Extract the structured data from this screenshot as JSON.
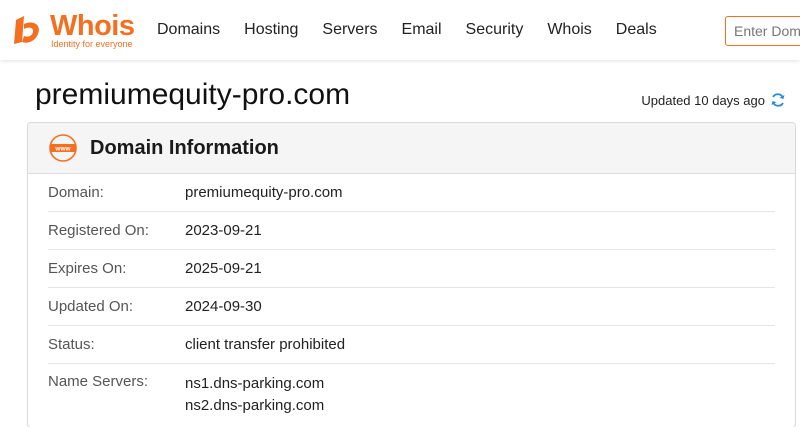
{
  "brand": {
    "name": "Whois",
    "tagline": "Identity for everyone",
    "accent": "#f37021"
  },
  "nav": {
    "items": [
      "Domains",
      "Hosting",
      "Servers",
      "Email",
      "Security",
      "Whois",
      "Deals"
    ]
  },
  "search": {
    "placeholder": "Enter Domain or IP"
  },
  "page": {
    "domain": "premiumequity-pro.com",
    "updated_text": "Updated 10 days ago"
  },
  "card": {
    "title": "Domain Information",
    "icon": "www-icon",
    "rows": [
      {
        "label": "Domain:",
        "value": "premiumequity-pro.com"
      },
      {
        "label": "Registered On:",
        "value": "2023-09-21"
      },
      {
        "label": "Expires On:",
        "value": "2025-09-21"
      },
      {
        "label": "Updated On:",
        "value": "2024-09-30"
      },
      {
        "label": "Status:",
        "value": "client transfer prohibited"
      }
    ],
    "name_servers": {
      "label": "Name Servers:",
      "values": [
        "ns1.dns-parking.com",
        "ns2.dns-parking.com"
      ]
    }
  }
}
